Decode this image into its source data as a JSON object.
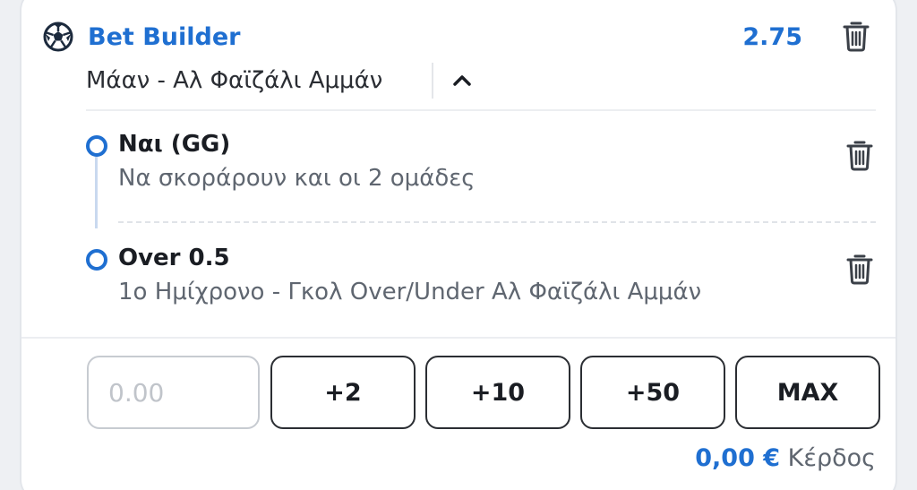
{
  "header": {
    "title": "Bet Builder",
    "odds": "2.75",
    "icon": "soccer-ball-icon"
  },
  "match": {
    "name": "Μάαν - Αλ Φαϊζάλι Αμμάν",
    "toggle_icon": "chevron-up-icon"
  },
  "selections": [
    {
      "title": "Ναι (GG)",
      "market": "Να σκοράρουν και οι 2 ομάδες"
    },
    {
      "title": "Over 0.5",
      "market": "1ο Ημίχρονο - Γκολ Over/Under Αλ Φαϊζάλι Αμμάν"
    }
  ],
  "stake": {
    "placeholder": "0.00",
    "quick_amounts": [
      "+2",
      "+10",
      "+50",
      "MAX"
    ]
  },
  "profit": {
    "amount": "0,00 €",
    "label": "Κέρδος"
  },
  "colors": {
    "accent": "#1f6fd1",
    "text": "#1a1d23",
    "muted": "#5f6670",
    "border": "#2b2e33"
  }
}
